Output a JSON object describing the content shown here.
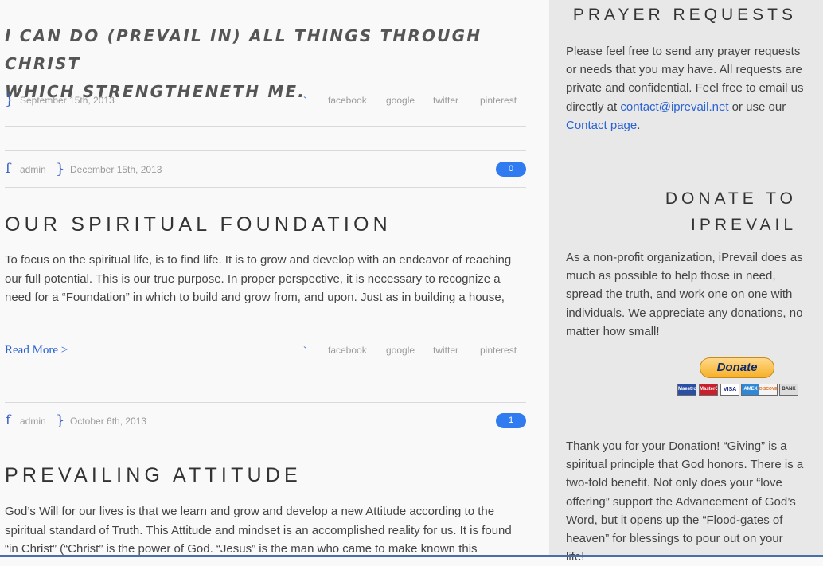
{
  "quote": {
    "line1": "I CAN DO (PREVAIL IN) ALL THINGS THROUGH CHRIST",
    "line2": "WHICH STRENGTHENETH ME.",
    "date": "September 15th, 2013",
    "share": [
      "facebook",
      "google",
      "twitter",
      "pinterest"
    ]
  },
  "posts": [
    {
      "author": "admin",
      "date": "December 15th, 2013",
      "comments": "0",
      "title": "OUR SPIRITUAL FOUNDATION",
      "excerpt": "To focus on the spiritual life, is to find life.  It is to grow and develop with an endeavor of reaching our full potential.  This is our true purpose. In proper perspective, it is necessary to recognize a need for a “Foundation” in which to build and grow from, and upon.  Just as in building a house,",
      "read_more": "Read More >",
      "share": [
        "facebook",
        "google",
        "twitter",
        "pinterest"
      ]
    },
    {
      "author": "admin",
      "date": "October 6th, 2013",
      "comments": "1",
      "title": "PREVAILING ATTITUDE",
      "excerpt": "God’s Will for our lives is that we learn and grow and develop a new Attitude according to the spiritual standard of Truth.  This Attitude and mindset is an accomplished reality for us.  It is found “in Christ”  (“Christ” is the power of God.  “Jesus” is the man who came to make known this"
    }
  ],
  "sidebar": {
    "prayer": {
      "title": "PRAYER REQUESTS",
      "text_before": "Please feel free to send any prayer requests or needs that you may have. All requests are private and confidential. Feel free to email us directly at ",
      "email": "contact@iprevail.net",
      "text_mid": " or use our ",
      "contact_link": "Contact page",
      "text_after": "."
    },
    "donate": {
      "title_line1": "DONATE TO",
      "title_line2": "IPREVAIL",
      "text": "As a non-profit organization, iPrevail does as much as possible to help those in need, spread the truth, and work one on one with individuals. We appreciate any donations, no matter how small!",
      "button": "Donate",
      "cards": [
        "Maestro",
        "MasterCard",
        "VISA",
        "AMEX",
        "DISCOVER",
        "BANK"
      ],
      "thanks": "Thank you for your Donation! “Giving” is a spiritual principle that God honors. There is a two-fold benefit. Not only does your “love offering” support the Advancement of God’s Word, but it opens up the “Flood-gates of heaven” for blessings to pour out on your life!"
    }
  }
}
